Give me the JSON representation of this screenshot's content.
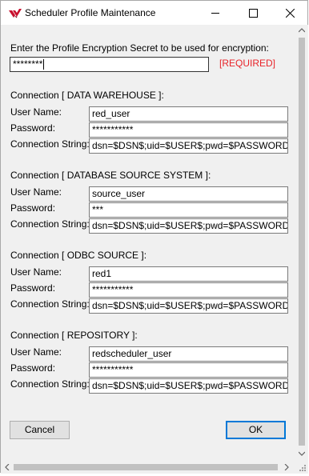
{
  "window": {
    "title": "Scheduler Profile Maintenance"
  },
  "icons": {
    "app": "wherescape-red-logo-icon",
    "minimize": "minimize-icon",
    "maximize": "maximize-icon",
    "close": "close-icon"
  },
  "encryption": {
    "prompt": "Enter the Profile Encryption Secret to be used for encryption:",
    "value": "********",
    "required_label": "[REQUIRED]",
    "required_color": "#e8242a"
  },
  "labels": {
    "user_name": "User Name:",
    "password": "Password:",
    "connection_string": "Connection String:"
  },
  "connections": [
    {
      "heading": "Connection [ DATA WAREHOUSE ]:",
      "user_name": "red_user",
      "password": "***********",
      "connection_string": "dsn=$DSN$;uid=$USER$;pwd=$PASSWORD$;"
    },
    {
      "heading": "Connection [ DATABASE SOURCE SYSTEM ]:",
      "user_name": "source_user",
      "password": "***",
      "connection_string": "dsn=$DSN$;uid=$USER$;pwd=$PASSWORD$;"
    },
    {
      "heading": "Connection [ ODBC SOURCE ]:",
      "user_name": "red1",
      "password": "***********",
      "connection_string": "dsn=$DSN$;uid=$USER$;pwd=$PASSWORD$;"
    },
    {
      "heading": "Connection [ REPOSITORY ]:",
      "user_name": "redscheduler_user",
      "password": "***********",
      "connection_string": "dsn=$DSN$;uid=$USER$;pwd=$PASSWORD$;"
    }
  ],
  "buttons": {
    "cancel": "Cancel",
    "ok": "OK"
  }
}
